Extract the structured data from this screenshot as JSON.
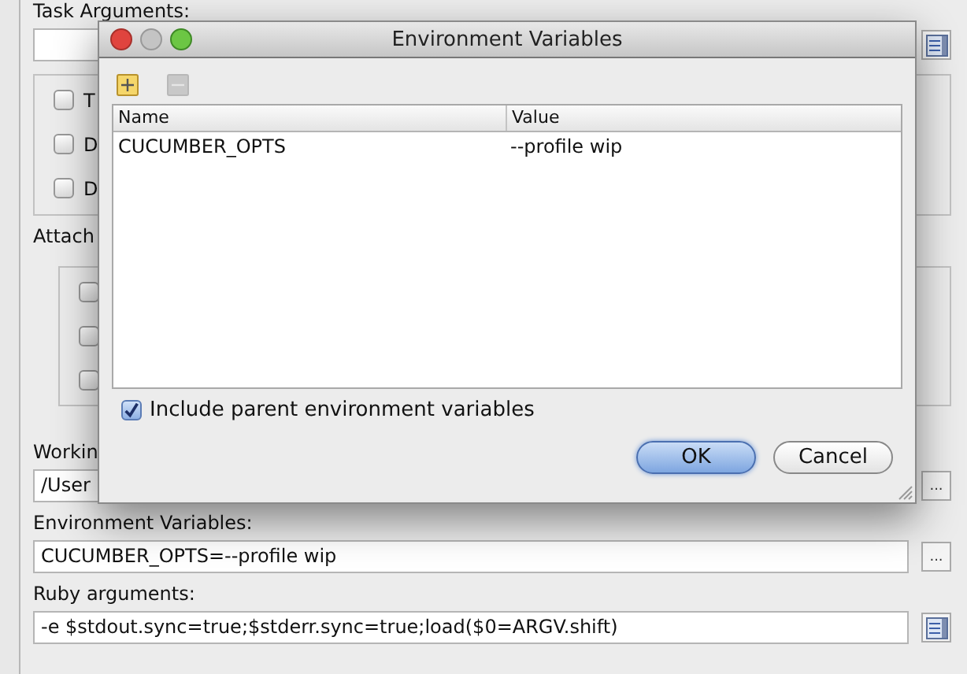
{
  "panel": {
    "task_arguments": {
      "label": "Task Arguments:"
    },
    "options": [
      {
        "label": "T",
        "checked": false
      },
      {
        "label": "D",
        "checked": false
      },
      {
        "label": "D",
        "checked": false
      }
    ],
    "attach": {
      "label": "Attach",
      "options": [
        {
          "checked": false
        },
        {
          "checked": false
        },
        {
          "checked": false
        }
      ]
    },
    "working_dir": {
      "label": "Workin",
      "value": "/User",
      "browse": "..."
    },
    "environment_variables": {
      "label": "Environment Variables:",
      "value": "CUCUMBER_OPTS=--profile wip",
      "browse": "..."
    },
    "ruby_arguments": {
      "label": "Ruby arguments:",
      "value": "-e $stdout.sync=true;$stderr.sync=true;load($0=ARGV.shift)"
    }
  },
  "dialog": {
    "title": "Environment Variables",
    "toolbar": [
      {
        "kind": "add",
        "disabled": false
      },
      {
        "kind": "remove",
        "disabled": true
      }
    ],
    "table": {
      "columns": [
        "Name",
        "Value"
      ],
      "rows": [
        [
          "CUCUMBER_OPTS",
          "--profile wip"
        ]
      ]
    },
    "include_parent": {
      "label": "Include parent environment variables",
      "checked": true
    },
    "buttons": [
      {
        "label": "OK",
        "default": true
      },
      {
        "label": "Cancel",
        "default": false
      }
    ]
  }
}
